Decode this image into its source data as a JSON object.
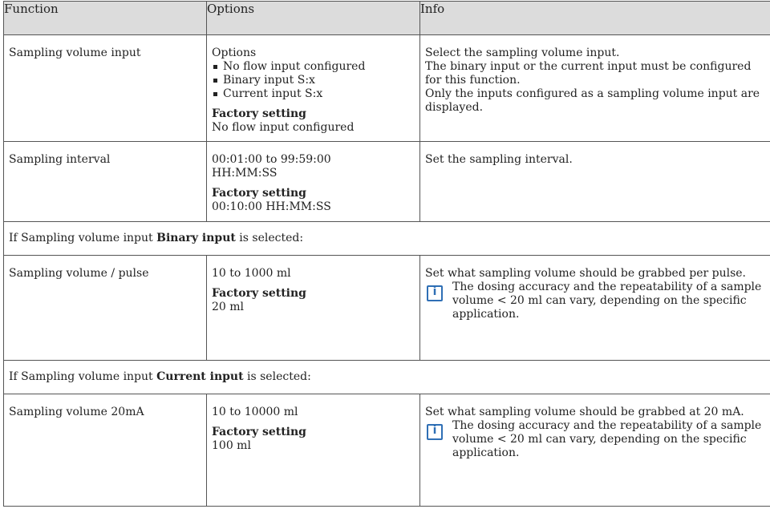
{
  "header": {
    "function": "Function",
    "options": "Options",
    "info": "Info"
  },
  "rows": [
    {
      "function": "Sampling volume input",
      "options_label": "Options",
      "options_items": [
        "No flow input configured",
        "Binary input S:x",
        "Current input S:x"
      ],
      "factory_title": "Factory setting",
      "factory_value": "No flow input configured",
      "info_lines": [
        "Select the sampling volume input.",
        "The binary input or the current input must be configured for this function.",
        "Only the inputs configured as a sampling volume input are displayed."
      ]
    },
    {
      "function": "Sampling interval",
      "range": "00:01:00 to 99:59:00",
      "unit": "HH:MM:SS",
      "factory_title": "Factory setting",
      "factory_value": "00:10:00 HH:MM:SS",
      "info": "Set the sampling interval."
    }
  ],
  "condition_binary": {
    "prefix": "If Sampling volume input ",
    "bold": "Binary input",
    "suffix": " is selected:"
  },
  "row_binary": {
    "function": "Sampling volume / pulse",
    "range": "10 to 1000 ml",
    "factory_title": "Factory setting",
    "factory_value": "20 ml",
    "info": "Set what sampling volume should be grabbed per pulse.",
    "note": "The dosing accuracy and the repeatability of a sample volume < 20 ml can vary, depending on the specific application.",
    "note_icon": "info-icon"
  },
  "condition_current": {
    "prefix": "If Sampling volume input ",
    "bold": "Current input",
    "suffix": " is selected:"
  },
  "row_current": {
    "function": "Sampling volume 20mA",
    "range": "10 to 10000 ml",
    "factory_title": "Factory setting",
    "factory_value": "100 ml",
    "info": "Set what sampling volume should be grabbed at 20 mA.",
    "note": "The dosing accuracy and the repeatability of a sample volume < 20 ml can vary, depending on the specific application.",
    "note_icon": "info-icon"
  },
  "colors": {
    "header_bg": "#dcdcdc",
    "info_icon": "#2f6fb5",
    "border": "#555555"
  }
}
